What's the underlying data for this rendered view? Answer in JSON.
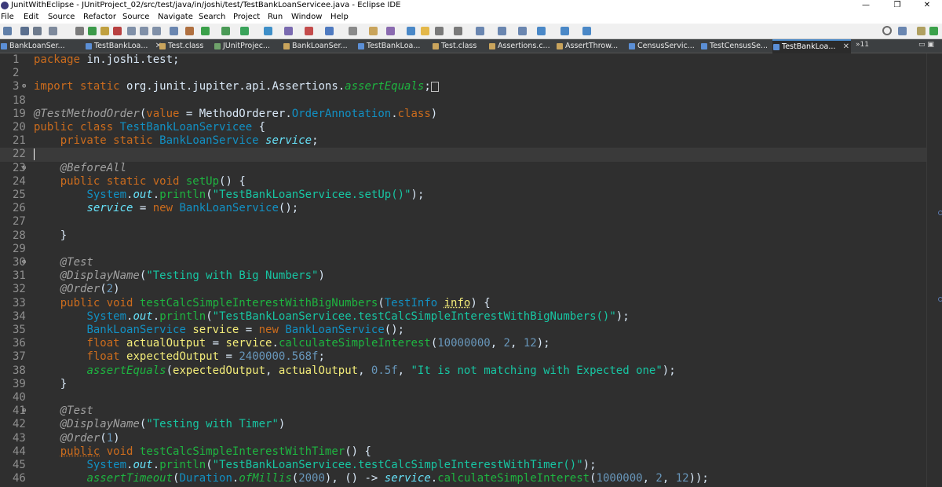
{
  "window": {
    "title": "JunitWithEclipse - JUnitProject_02/src/test/java/in/joshi/test/TestBankLoanServicee.java - Eclipse IDE",
    "min_glyph": "—",
    "max_glyph": "❐",
    "close_glyph": "✕"
  },
  "menu": [
    "File",
    "Edit",
    "Source",
    "Refactor",
    "Source",
    "Navigate",
    "Search",
    "Project",
    "Run",
    "Window",
    "Help"
  ],
  "tabs": [
    {
      "label": "BankLoanSer...",
      "icon": "java-file-icon"
    },
    {
      "label": "TestBankLoa...",
      "icon": "java-file-icon",
      "active": true,
      "close": "✕"
    },
    {
      "label": "Test.class",
      "icon": "class-file-icon"
    },
    {
      "label": "JUnitProjec...",
      "icon": "junit-icon"
    },
    {
      "label": "BankLoanSer...",
      "icon": "class-file-icon"
    },
    {
      "label": "TestBankLoa...",
      "icon": "java-file-icon"
    },
    {
      "label": "Test.class",
      "icon": "class-file-icon"
    },
    {
      "label": "Assertions.c...",
      "icon": "class-file-icon"
    },
    {
      "label": "AssertThrow...",
      "icon": "class-file-icon"
    },
    {
      "label": "CensusServic...",
      "icon": "java-file-icon"
    },
    {
      "label": "TestCensusSe...",
      "icon": "java-file-icon"
    },
    {
      "label": "TestBankLoa...",
      "icon": "java-file-icon",
      "active": true,
      "close": "✕"
    }
  ],
  "tab_overflow": "»11",
  "code_lines": [
    {
      "n": "1",
      "tokens": [
        [
          "kw",
          "package"
        ],
        [
          "plain",
          " in.joshi.test;"
        ]
      ]
    },
    {
      "n": "2",
      "tokens": []
    },
    {
      "n": "3",
      "fold": "⊕",
      "tokens": [
        [
          "kw",
          "import"
        ],
        [
          "plain",
          " "
        ],
        [
          "kw",
          "static"
        ],
        [
          "plain",
          " org.junit.jupiter.api.Assertions."
        ],
        [
          "mth static",
          "assertEquals"
        ],
        [
          "plain",
          ";"
        ]
      ],
      "box": true
    },
    {
      "n": "18",
      "tokens": []
    },
    {
      "n": "19",
      "tokens": [
        [
          "ann",
          "@TestMethodOrder"
        ],
        [
          "plain",
          "("
        ],
        [
          "kw",
          "value"
        ],
        [
          "plain",
          " = MethodOrderer."
        ],
        [
          "typ",
          "OrderAnnotation"
        ],
        [
          "plain",
          "."
        ],
        [
          "kw",
          "class"
        ],
        [
          "plain",
          ")"
        ]
      ]
    },
    {
      "n": "20",
      "tokens": [
        [
          "kw",
          "public class"
        ],
        [
          "plain",
          " "
        ],
        [
          "typ",
          "TestBankLoanServicee"
        ],
        [
          "plain",
          " {"
        ]
      ]
    },
    {
      "n": "21",
      "tokens": [
        [
          "plain",
          "    "
        ],
        [
          "kw",
          "private static"
        ],
        [
          "plain",
          " "
        ],
        [
          "typ",
          "BankLoanService"
        ],
        [
          "plain",
          " "
        ],
        [
          "fld",
          "service"
        ],
        [
          "plain",
          ";"
        ]
      ]
    },
    {
      "n": "22",
      "current": true,
      "tokens": []
    },
    {
      "n": "23",
      "fold": "⊕",
      "tokens": [
        [
          "plain",
          "    "
        ],
        [
          "ann",
          "@BeforeAll"
        ]
      ]
    },
    {
      "n": "24",
      "tokens": [
        [
          "plain",
          "    "
        ],
        [
          "kw",
          "public static void"
        ],
        [
          "plain",
          " "
        ],
        [
          "mth",
          "setUp"
        ],
        [
          "plain",
          "() {"
        ]
      ]
    },
    {
      "n": "25",
      "tokens": [
        [
          "plain",
          "        "
        ],
        [
          "typ",
          "System"
        ],
        [
          "plain",
          "."
        ],
        [
          "fld",
          "out"
        ],
        [
          "plain",
          "."
        ],
        [
          "mth",
          "println"
        ],
        [
          "plain",
          "("
        ],
        [
          "str",
          "\"TestBankLoanServicee.setUp()\""
        ],
        [
          "plain",
          ");"
        ]
      ]
    },
    {
      "n": "26",
      "tokens": [
        [
          "plain",
          "        "
        ],
        [
          "fld",
          "service"
        ],
        [
          "plain",
          " = "
        ],
        [
          "kw",
          "new"
        ],
        [
          "plain",
          " "
        ],
        [
          "typ",
          "BankLoanService"
        ],
        [
          "plain",
          "();"
        ]
      ]
    },
    {
      "n": "27",
      "tokens": []
    },
    {
      "n": "28",
      "tokens": [
        [
          "plain",
          "    }"
        ]
      ]
    },
    {
      "n": "29",
      "tokens": []
    },
    {
      "n": "30",
      "fold": "⊕",
      "tokens": [
        [
          "plain",
          "    "
        ],
        [
          "ann",
          "@Test"
        ]
      ]
    },
    {
      "n": "31",
      "tokens": [
        [
          "plain",
          "    "
        ],
        [
          "ann",
          "@DisplayName"
        ],
        [
          "plain",
          "("
        ],
        [
          "str",
          "\"Testing with Big Numbers\""
        ],
        [
          "plain",
          ")"
        ]
      ]
    },
    {
      "n": "32",
      "tokens": [
        [
          "plain",
          "    "
        ],
        [
          "ann",
          "@Order"
        ],
        [
          "plain",
          "("
        ],
        [
          "num",
          "2"
        ],
        [
          "plain",
          ")"
        ]
      ]
    },
    {
      "n": "33",
      "tokens": [
        [
          "plain",
          "    "
        ],
        [
          "kw",
          "public void"
        ],
        [
          "plain",
          " "
        ],
        [
          "mth",
          "testCalcSimpleInterestWithBigNumbers"
        ],
        [
          "plain",
          "("
        ],
        [
          "typ",
          "TestInfo"
        ],
        [
          "plain",
          " "
        ],
        [
          "var ul",
          "info"
        ],
        [
          "plain",
          ") {"
        ]
      ]
    },
    {
      "n": "34",
      "tokens": [
        [
          "plain",
          "        "
        ],
        [
          "typ",
          "System"
        ],
        [
          "plain",
          "."
        ],
        [
          "fld",
          "out"
        ],
        [
          "plain",
          "."
        ],
        [
          "mth",
          "println"
        ],
        [
          "plain",
          "("
        ],
        [
          "str",
          "\"TestBankLoanServicee.testCalcSimpleInterestWithBigNumbers()\""
        ],
        [
          "plain",
          ");"
        ]
      ]
    },
    {
      "n": "35",
      "tokens": [
        [
          "plain",
          "        "
        ],
        [
          "typ",
          "BankLoanService"
        ],
        [
          "plain",
          " "
        ],
        [
          "var",
          "service"
        ],
        [
          "plain",
          " = "
        ],
        [
          "kw",
          "new"
        ],
        [
          "plain",
          " "
        ],
        [
          "typ",
          "BankLoanService"
        ],
        [
          "plain",
          "();"
        ]
      ]
    },
    {
      "n": "36",
      "tokens": [
        [
          "plain",
          "        "
        ],
        [
          "kw",
          "float"
        ],
        [
          "plain",
          " "
        ],
        [
          "var",
          "actualOutput"
        ],
        [
          "plain",
          " = "
        ],
        [
          "var",
          "service"
        ],
        [
          "plain",
          "."
        ],
        [
          "mth",
          "calculateSimpleInterest"
        ],
        [
          "plain",
          "("
        ],
        [
          "num",
          "10000000"
        ],
        [
          "plain",
          ", "
        ],
        [
          "num",
          "2"
        ],
        [
          "plain",
          ", "
        ],
        [
          "num",
          "12"
        ],
        [
          "plain",
          ");"
        ]
      ]
    },
    {
      "n": "37",
      "tokens": [
        [
          "plain",
          "        "
        ],
        [
          "kw",
          "float"
        ],
        [
          "plain",
          " "
        ],
        [
          "var",
          "expectedOutput"
        ],
        [
          "plain",
          " = "
        ],
        [
          "num",
          "2400000.568f"
        ],
        [
          "plain",
          ";"
        ]
      ]
    },
    {
      "n": "38",
      "tokens": [
        [
          "plain",
          "        "
        ],
        [
          "mth static",
          "assertEquals"
        ],
        [
          "plain",
          "("
        ],
        [
          "var",
          "expectedOutput"
        ],
        [
          "plain",
          ", "
        ],
        [
          "var",
          "actualOutput"
        ],
        [
          "plain",
          ", "
        ],
        [
          "num",
          "0.5f"
        ],
        [
          "plain",
          ", "
        ],
        [
          "str",
          "\"It is not matching with Expected one\""
        ],
        [
          "plain",
          ");"
        ]
      ]
    },
    {
      "n": "39",
      "tokens": [
        [
          "plain",
          "    }"
        ]
      ]
    },
    {
      "n": "40",
      "tokens": []
    },
    {
      "n": "41",
      "fold": "⊕",
      "tokens": [
        [
          "plain",
          "    "
        ],
        [
          "ann",
          "@Test"
        ]
      ]
    },
    {
      "n": "42",
      "tokens": [
        [
          "plain",
          "    "
        ],
        [
          "ann",
          "@DisplayName"
        ],
        [
          "plain",
          "("
        ],
        [
          "str",
          "\"Testing with Timer\""
        ],
        [
          "plain",
          ")"
        ]
      ]
    },
    {
      "n": "43",
      "tokens": [
        [
          "plain",
          "    "
        ],
        [
          "ann",
          "@Order"
        ],
        [
          "plain",
          "("
        ],
        [
          "num",
          "1"
        ],
        [
          "plain",
          ")"
        ]
      ]
    },
    {
      "n": "44",
      "tokens": [
        [
          "plain",
          "    "
        ],
        [
          "kw ul",
          "public"
        ],
        [
          "plain",
          " "
        ],
        [
          "kw",
          "void"
        ],
        [
          "plain",
          " "
        ],
        [
          "mth",
          "testCalcSimpleInterestWithTimer"
        ],
        [
          "plain",
          "() {"
        ]
      ]
    },
    {
      "n": "45",
      "tokens": [
        [
          "plain",
          "        "
        ],
        [
          "typ",
          "System"
        ],
        [
          "plain",
          "."
        ],
        [
          "fld",
          "out"
        ],
        [
          "plain",
          "."
        ],
        [
          "mth",
          "println"
        ],
        [
          "plain",
          "("
        ],
        [
          "str",
          "\"TestBankLoanServicee.testCalcSimpleInterestWithTimer()\""
        ],
        [
          "plain",
          ");"
        ]
      ]
    },
    {
      "n": "46",
      "tokens": [
        [
          "plain",
          "        "
        ],
        [
          "mth static",
          "assertTimeout"
        ],
        [
          "plain",
          "("
        ],
        [
          "typ",
          "Duration"
        ],
        [
          "plain",
          "."
        ],
        [
          "mth static",
          "ofMillis"
        ],
        [
          "plain",
          "("
        ],
        [
          "num",
          "2000"
        ],
        [
          "plain",
          "), () -> "
        ],
        [
          "fld",
          "service"
        ],
        [
          "plain",
          "."
        ],
        [
          "mth",
          "calculateSimpleInterest"
        ],
        [
          "plain",
          "("
        ],
        [
          "num",
          "1000000"
        ],
        [
          "plain",
          ", "
        ],
        [
          "num",
          "2"
        ],
        [
          "plain",
          ", "
        ],
        [
          "num",
          "12"
        ],
        [
          "plain",
          "));"
        ]
      ]
    }
  ]
}
